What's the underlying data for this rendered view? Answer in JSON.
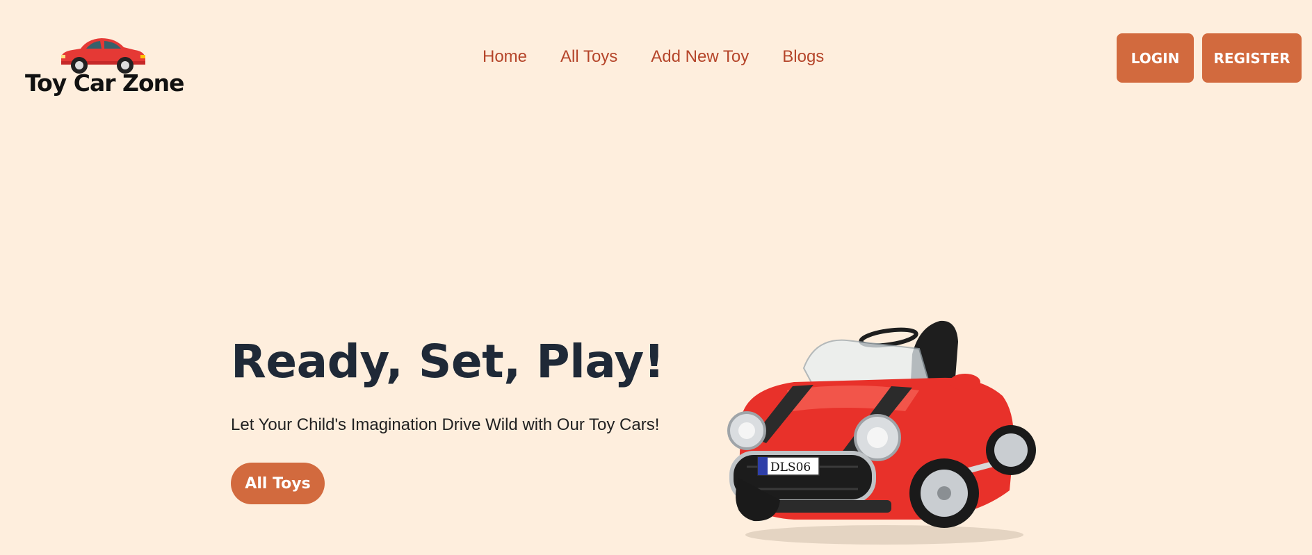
{
  "brand": {
    "name": "Toy Car Zone"
  },
  "nav": {
    "links": [
      "Home",
      "All Toys",
      "Add New Toy",
      "Blogs"
    ]
  },
  "auth": {
    "login_label": "LOGIN",
    "register_label": "REGISTER"
  },
  "hero": {
    "title": "Ready, Set, Play!",
    "subtitle": "Let Your Child's Imagination Drive Wild with Our Toy Cars!",
    "cta_label": "All Toys",
    "car_plate": "DLS06"
  },
  "colors": {
    "background": "#FEEEDD",
    "accent": "#D26A3E",
    "nav_text": "#B5452A",
    "heading": "#1F2937"
  }
}
